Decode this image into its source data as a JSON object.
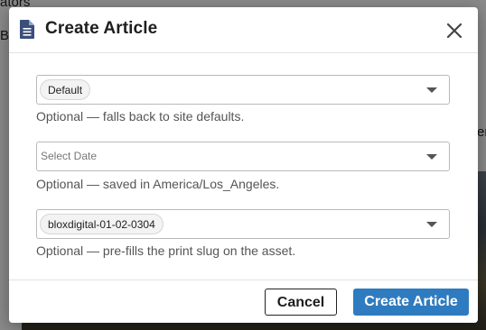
{
  "background": {
    "text_top": "ators",
    "text_left": "B",
    "text_right": "er"
  },
  "dialog": {
    "title": "Create Article",
    "icon": "document-icon",
    "close_icon": "close-icon"
  },
  "fields": {
    "template": {
      "selected": "Default",
      "help": "Optional — falls back to site defaults."
    },
    "date": {
      "placeholder": "Select Date",
      "help": "Optional — saved in America/Los_Angeles."
    },
    "slug": {
      "selected": "bloxdigital-01-02-0304",
      "help": "Optional — pre-fills the print slug on the asset."
    }
  },
  "footer": {
    "cancel_label": "Cancel",
    "create_label": "Create Article"
  },
  "colors": {
    "primary": "#2f7bbf",
    "icon": "#3a4f7a"
  }
}
